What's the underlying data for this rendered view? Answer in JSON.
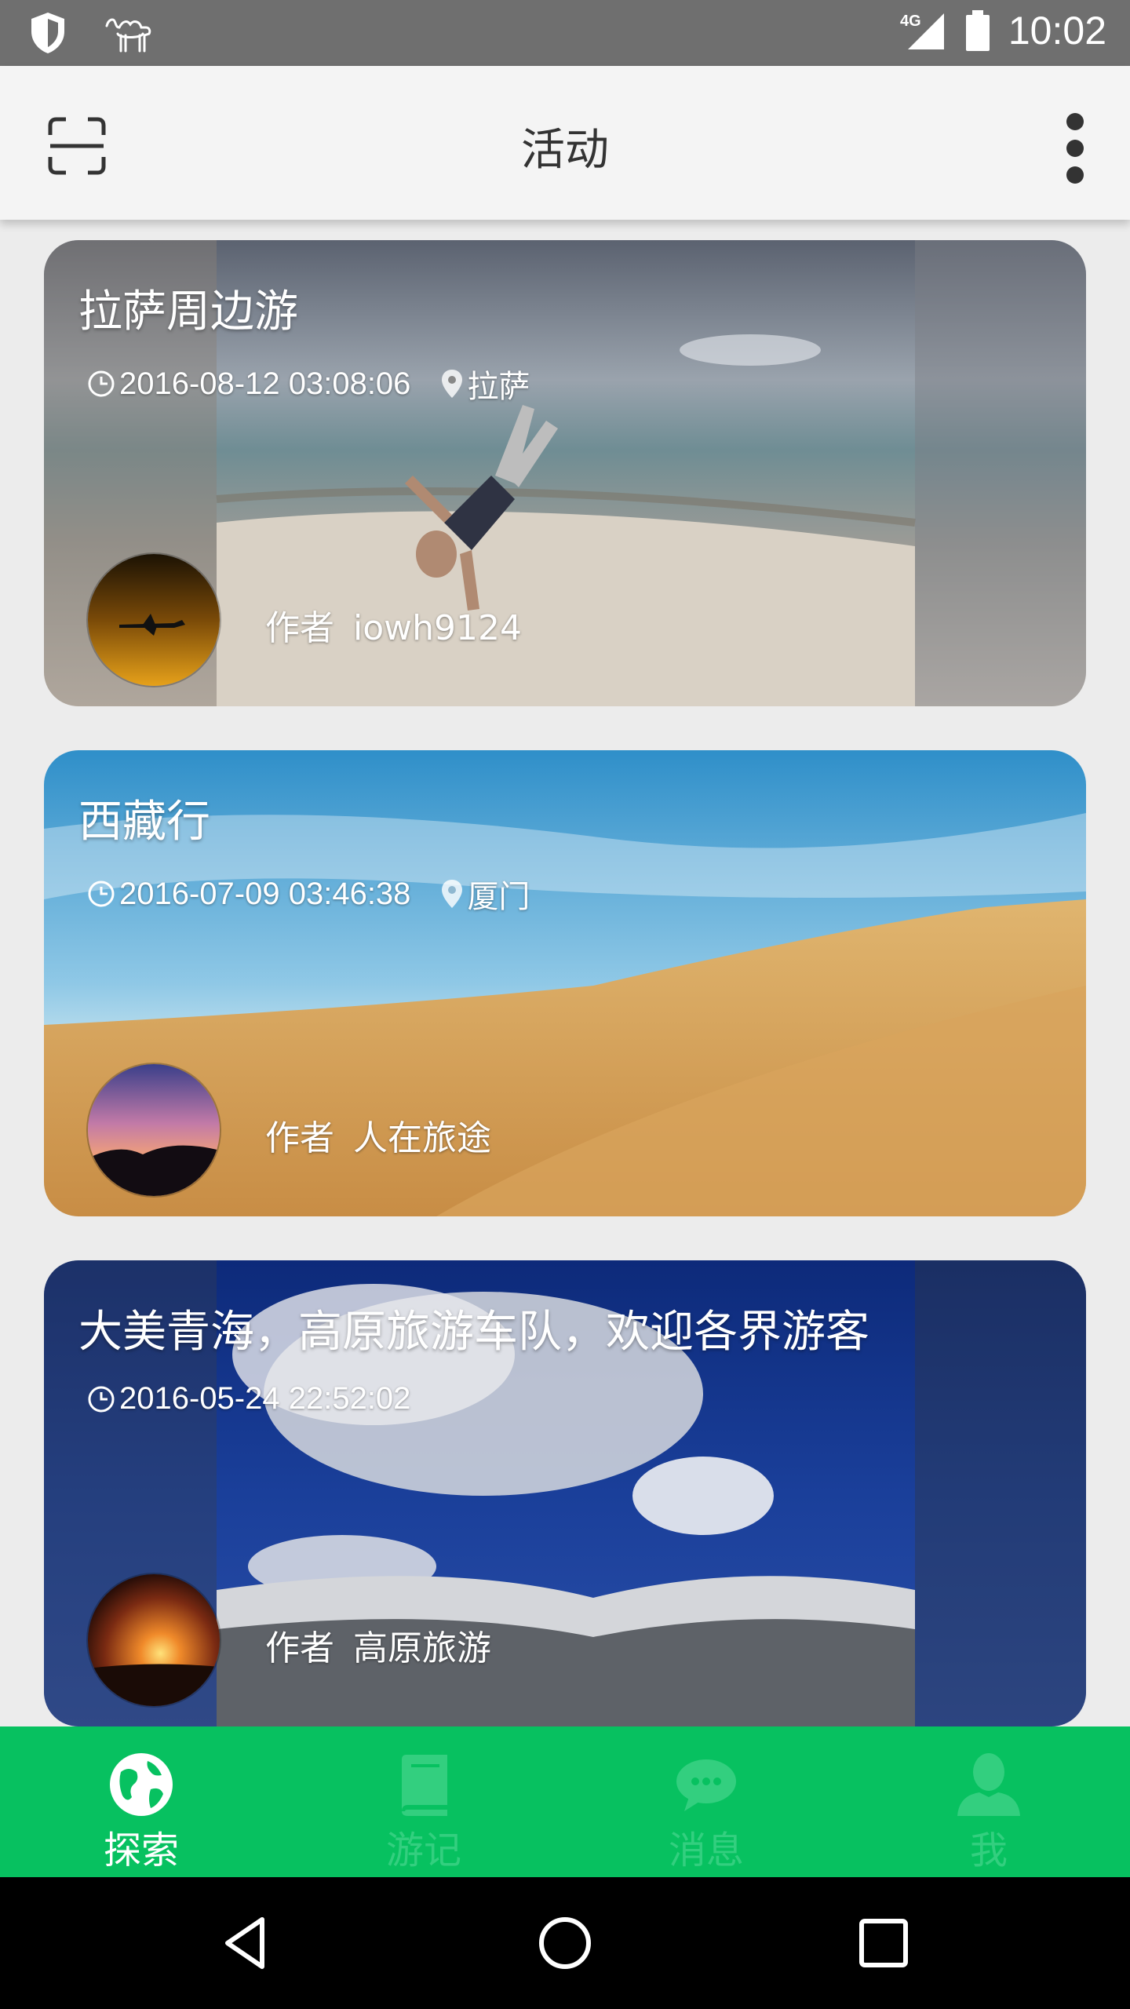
{
  "status_bar": {
    "time": "10:02",
    "network": "4G",
    "icons": [
      "shield-icon",
      "camel-icon",
      "signal-icon",
      "battery-icon"
    ]
  },
  "app_bar": {
    "title": "活动",
    "left_icon": "scan-icon",
    "right_icon": "more-vert-icon"
  },
  "cards": [
    {
      "title": "拉萨周边游",
      "datetime": "2016-08-12 03:08:06",
      "location": "拉萨",
      "author_label": "作者",
      "author_name": "iowh9124"
    },
    {
      "title": "西藏行",
      "datetime": "2016-07-09 03:46:38",
      "location": "厦门",
      "author_label": "作者",
      "author_name": "人在旅途"
    },
    {
      "title": "大美青海，高原旅游车队，欢迎各界游客",
      "datetime": "2016-05-24 22:52:02",
      "location": "",
      "author_label": "作者",
      "author_name": "高原旅游"
    }
  ],
  "bottom_nav": [
    {
      "label": "探索",
      "icon": "globe-icon",
      "active": true
    },
    {
      "label": "游记",
      "icon": "book-icon",
      "active": false
    },
    {
      "label": "消息",
      "icon": "chat-bubble-icon",
      "active": false
    },
    {
      "label": "我",
      "icon": "person-icon",
      "active": false
    }
  ],
  "system_nav": [
    "back-icon",
    "home-icon",
    "recents-icon"
  ],
  "colors": {
    "accent": "#07c160",
    "inactive_nav": "#33cf7f",
    "status_bar": "#6f6f6f",
    "app_bar": "#f4f4f4"
  }
}
